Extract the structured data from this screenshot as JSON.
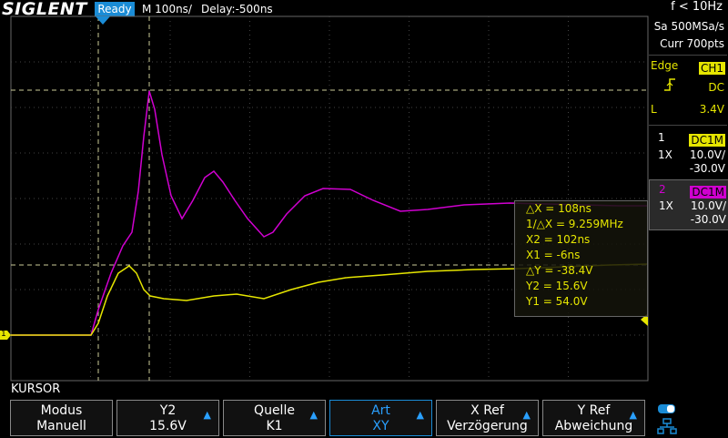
{
  "brand": "SIGLENT",
  "status": "Ready",
  "timebase": "M 100ns/",
  "delay": "Delay:-500ns",
  "trigger_freq": "f < 10Hz",
  "acquisition": {
    "sample_rate": "Sa 500MSa/s",
    "points": "Curr 700pts"
  },
  "trigger": {
    "type": "Edge",
    "source": "CH1",
    "slope_icon": "rising-edge-icon",
    "coupling": "DC",
    "mode": "L",
    "level": "3.4V"
  },
  "channels": [
    {
      "number": "1",
      "coupling": "DC1M",
      "probe": "1X",
      "scale": "10.0V/",
      "offset": "-30.0V",
      "color": "#e6e600"
    },
    {
      "number": "2",
      "coupling": "DC1M",
      "probe": "1X",
      "scale": "10.0V/",
      "offset": "-30.0V",
      "color": "#d000d0"
    }
  ],
  "cursor_readout": {
    "delta_x": "△X = 108ns",
    "inv_delta_x": "1/△X = 9.259MHz",
    "x2": "X2 = 102ns",
    "x1": "X1 = -6ns",
    "delta_y": "△Y = -38.4V",
    "y2": "Y2 = 15.6V",
    "y1": "Y1 = 54.0V"
  },
  "channel_marker": "1",
  "menu_title": "KURSOR",
  "softkeys": [
    {
      "label": "Modus",
      "value": "Manuell",
      "arrow": false
    },
    {
      "label": "Y2",
      "value": "15.6V",
      "arrow": true
    },
    {
      "label": "Quelle",
      "value": "K1",
      "arrow": true
    },
    {
      "label": "Art",
      "value": "XY",
      "arrow": true,
      "active": true
    },
    {
      "label": "X Ref",
      "value": "Verzögerung",
      "arrow": true
    },
    {
      "label": "Y Ref",
      "value": "Abweichung",
      "arrow": true
    }
  ],
  "colors": {
    "ch1": "#e6e600",
    "ch2": "#d000d0",
    "accent": "#1a8cd6",
    "grid": "#555555"
  }
}
